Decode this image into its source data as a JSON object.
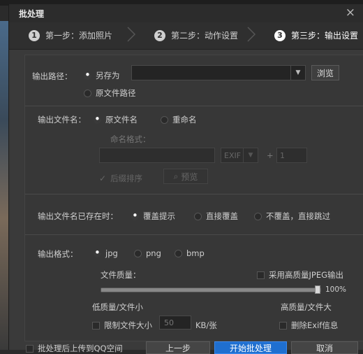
{
  "window": {
    "title": "批处理",
    "close_glyph": "×"
  },
  "steps": [
    {
      "num": "1",
      "label": "第一步：添加照片"
    },
    {
      "num": "2",
      "label": "第二步：动作设置"
    },
    {
      "num": "3",
      "label": "第三步：输出设置"
    }
  ],
  "output_path": {
    "label": "输出路径：",
    "opt_save_as": "另存为",
    "opt_original": "原文件路径",
    "path_value": "",
    "browse": "浏览"
  },
  "filename": {
    "label": "输出文件名：",
    "opt_original": "原文件名",
    "opt_rename": "重命名",
    "format_label": "命名格式：",
    "exif_value": "EXIF",
    "plus": "+",
    "start_value": "1",
    "suffix_check": "后缀排序",
    "preview": "预览"
  },
  "exists": {
    "label": "输出文件名已存在时：",
    "opt_prompt": "覆盖提示",
    "opt_overwrite": "直接覆盖",
    "opt_skip": "不覆盖，直接跳过"
  },
  "format": {
    "label": "输出格式：",
    "opt_jpg": "jpg",
    "opt_png": "png",
    "opt_bmp": "bmp",
    "quality_label": "文件质量：",
    "hq_check": "采用高质量JPEG输出",
    "quality_value": 100,
    "quality_text": "100%",
    "low_label": "低质量/文件小",
    "high_label": "高质量/文件大",
    "limit_check": "限制文件大小",
    "limit_value": "50",
    "limit_unit": "KB/张",
    "exif_check": "删除Exif信息"
  },
  "footer": {
    "upload_check": "批处理后上传到QQ空间",
    "prev": "上一步",
    "start": "开始批处理",
    "cancel": "取消"
  }
}
